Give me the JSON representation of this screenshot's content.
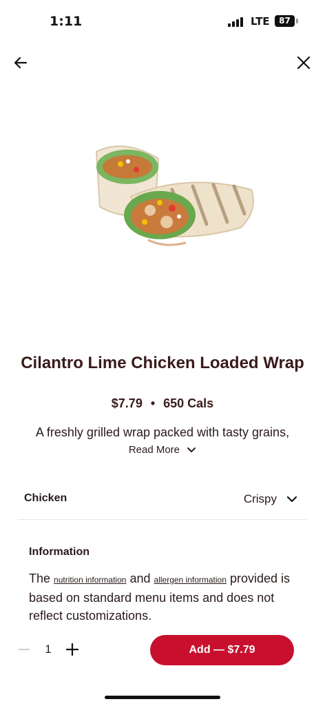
{
  "status_bar": {
    "time": "1:11",
    "network": "LTE",
    "battery": "87"
  },
  "nav": {
    "back_icon": "arrow-left-icon",
    "close_icon": "close-icon"
  },
  "product": {
    "image_icon": "wrap-image",
    "title": "Cilantro Lime Chicken Loaded Wrap",
    "price": "$7.79",
    "separator": "•",
    "calories": "650 Cals",
    "description": "A freshly grilled wrap packed with tasty grains,",
    "read_more": "Read More"
  },
  "option": {
    "label": "Chicken",
    "value": "Crispy"
  },
  "info": {
    "heading": "Information",
    "text_prefix": "The",
    "nutrition_link": "nutrition information",
    "and_word": "and",
    "allergen_link": "allergen information",
    "text_suffix": "provided is based on standard menu items and does not reflect customizations."
  },
  "cart": {
    "quantity": "1",
    "add_label": "Add — $7.79"
  },
  "colors": {
    "accent": "#c8102e",
    "text": "#2a1a1a"
  }
}
